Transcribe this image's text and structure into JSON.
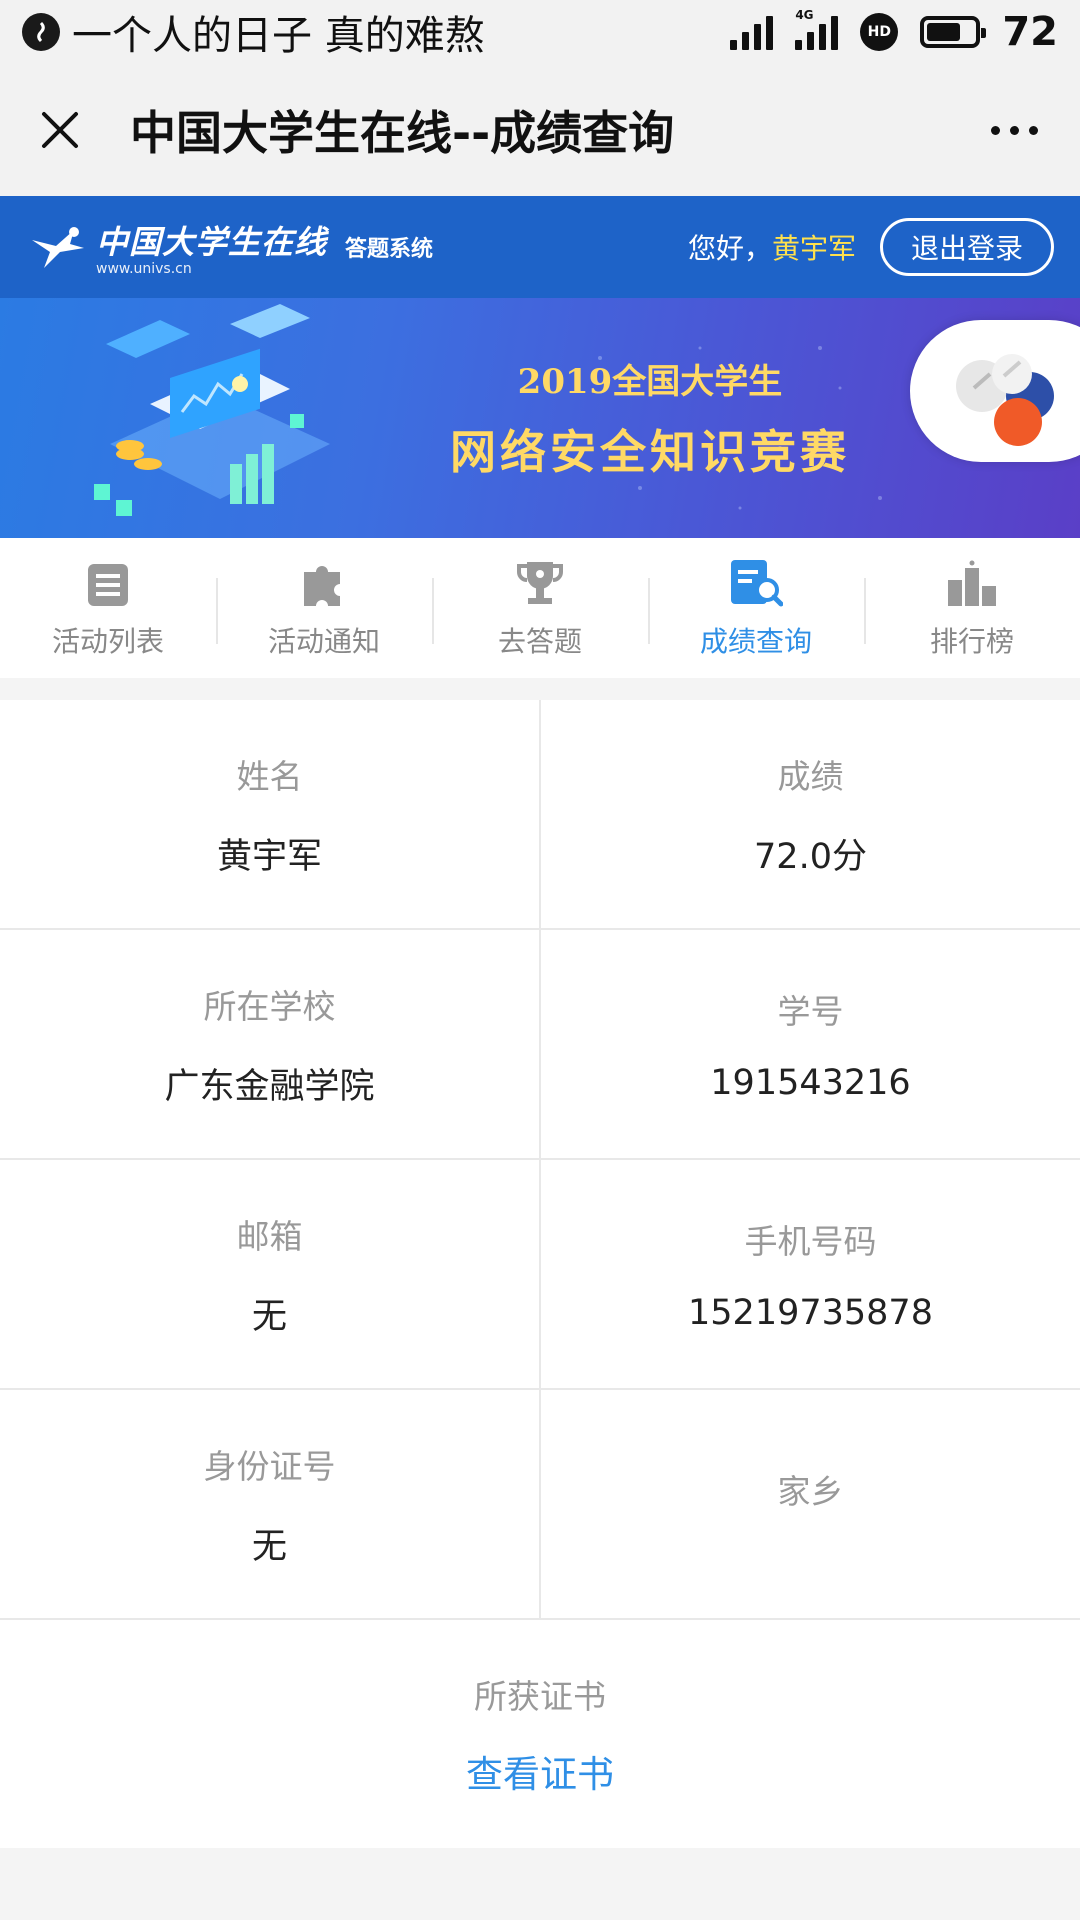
{
  "status_bar": {
    "title": "一个人的日子 真的难熬",
    "network": "4G",
    "hd": "HD",
    "battery": "72",
    "battery_level": 0.72
  },
  "nav": {
    "title": "中国大学生在线--成绩查询"
  },
  "header": {
    "logo_text": "中国大学生在线",
    "logo_url": "www.univs.cn",
    "logo_sub": "答题系统",
    "greeting": "您好，",
    "user_name": "黄宇军",
    "logout_label": "退出登录"
  },
  "banner": {
    "line1": "2019全国大学生",
    "line2": "网络安全知识竞赛"
  },
  "tabs": [
    {
      "label": "活动列表",
      "icon": "list-icon",
      "active": false
    },
    {
      "label": "活动通知",
      "icon": "puzzle-icon",
      "active": false
    },
    {
      "label": "去答题",
      "icon": "trophy-icon",
      "active": false
    },
    {
      "label": "成绩查询",
      "icon": "score-search-icon",
      "active": true
    },
    {
      "label": "排行榜",
      "icon": "ranking-icon",
      "active": false
    }
  ],
  "info": {
    "name_label": "姓名",
    "name_value": "黄宇军",
    "score_label": "成绩",
    "score_value": "72.0分",
    "school_label": "所在学校",
    "school_value": "广东金融学院",
    "student_id_label": "学号",
    "student_id_value": "191543216",
    "email_label": "邮箱",
    "email_value": "无",
    "phone_label": "手机号码",
    "phone_value": "15219735878",
    "id_card_label": "身份证号",
    "id_card_value": "无",
    "hometown_label": "家乡",
    "hometown_value": ""
  },
  "certificate": {
    "label": "所获证书",
    "link": "查看证书"
  },
  "colors": {
    "header_blue": "#1e63c8",
    "accent_blue": "#2f8fe6",
    "greeting_name": "#ffe14d",
    "banner_gold": "#ffd965"
  }
}
